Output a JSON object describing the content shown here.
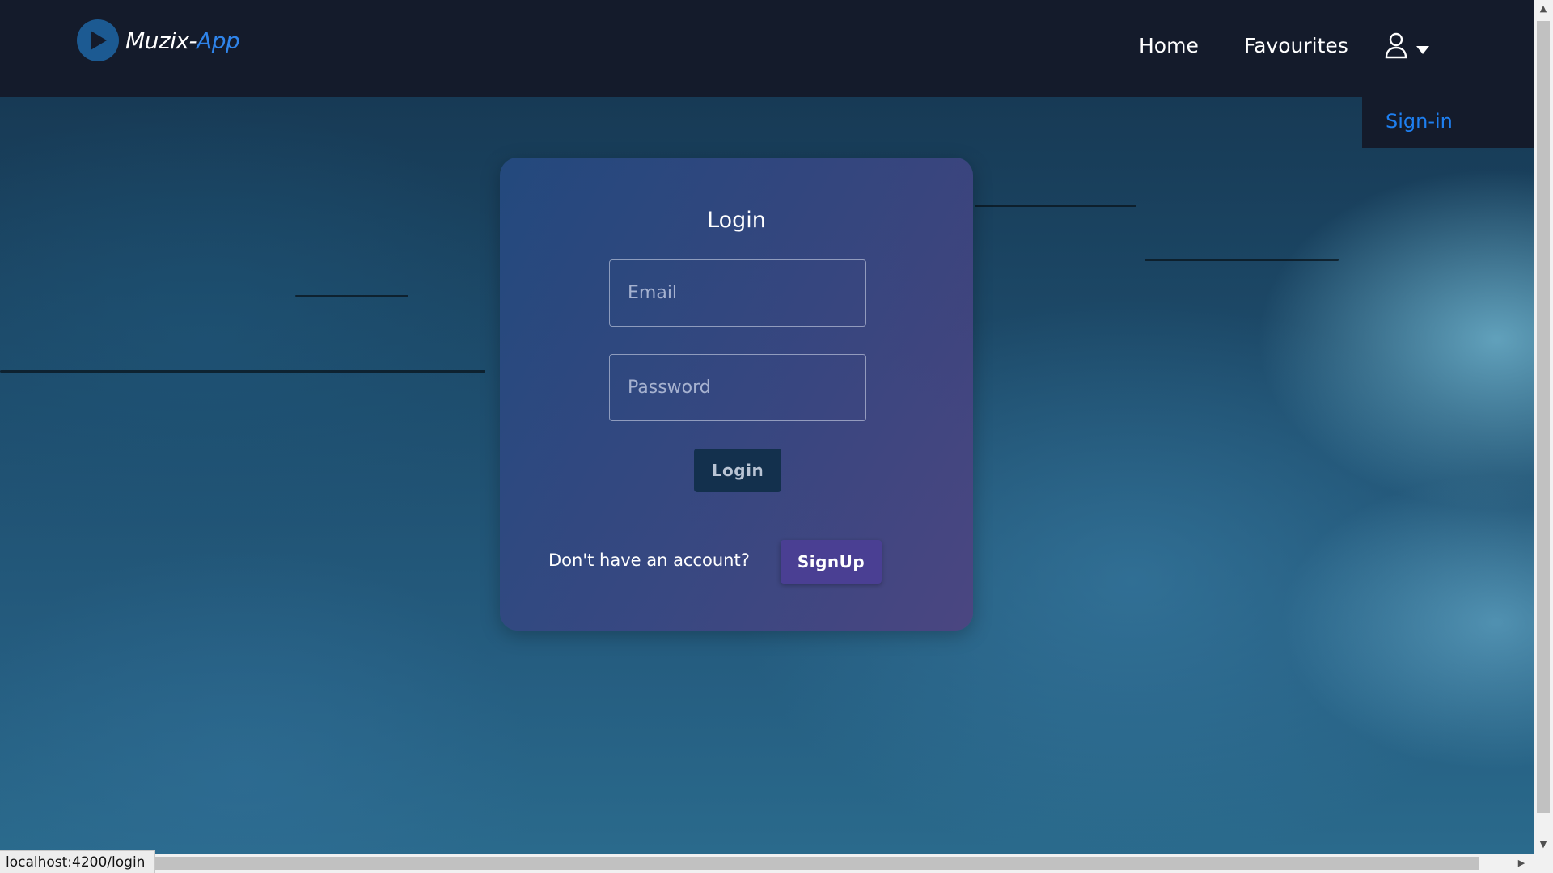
{
  "navbar": {
    "logo": {
      "text_main": "Muzix-",
      "text_accent": "App",
      "icon": "play-circle-icon"
    },
    "links": [
      {
        "label": "Home"
      },
      {
        "label": "Favourites"
      }
    ],
    "user_menu": {
      "icon": "user-icon",
      "caret_icon": "caret-down-icon"
    },
    "dropdown": {
      "items": [
        {
          "label": "Sign-in"
        }
      ]
    }
  },
  "login_card": {
    "title": "Login",
    "email_placeholder": "Email",
    "password_placeholder": "Password",
    "login_button": "Login",
    "signup_prompt": "Don't have an account?",
    "signup_button": "SignUp"
  },
  "status_bar": {
    "url": "localhost:4200/login"
  },
  "colors": {
    "navbar_bg": "#141b2b",
    "accent_blue": "#2f84ea",
    "signin_link": "#1e7ff0",
    "signup_button": "#4a3f93",
    "login_button": "#13304d"
  }
}
